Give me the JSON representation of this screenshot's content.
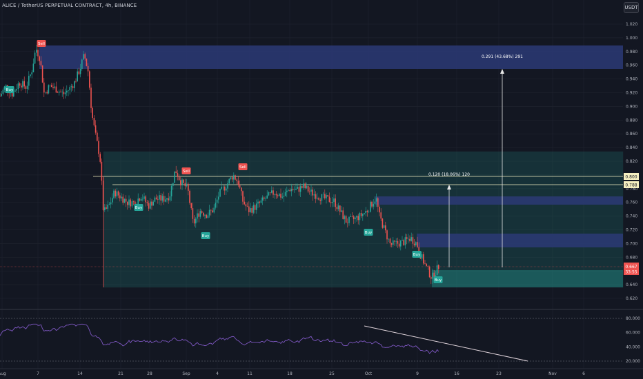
{
  "header": {
    "title": "ALICE / TetherUS PERPETUAL CONTRACT, 4h, BINANCE",
    "currency": "USDT"
  },
  "price_axis": {
    "ticks": [
      "1.020",
      "1.000",
      "0.980",
      "0.960",
      "0.940",
      "0.920",
      "0.900",
      "0.880",
      "0.860",
      "0.840",
      "0.820",
      "0.800",
      "0.780",
      "0.760",
      "0.740",
      "0.720",
      "0.700",
      "0.680",
      "0.660",
      "0.640",
      "0.620"
    ],
    "tick_values": [
      1.02,
      1.0,
      0.98,
      0.96,
      0.94,
      0.92,
      0.9,
      0.88,
      0.86,
      0.84,
      0.82,
      0.8,
      0.78,
      0.76,
      0.74,
      0.72,
      0.7,
      0.68,
      0.66,
      0.64,
      0.62
    ],
    "label_800": "0.800",
    "label_788": "0.788",
    "last_price": "0.667",
    "countdown": "33:55"
  },
  "rsi_axis": {
    "ticks": [
      "80.000",
      "60.000",
      "40.000",
      "20.000"
    ],
    "tick_values": [
      80,
      60,
      40,
      20
    ]
  },
  "time_axis": {
    "labels": [
      "Aug",
      "7",
      "14",
      "21",
      "28",
      "Sep",
      "4",
      "11",
      "18",
      "25",
      "Oct",
      "9",
      "16",
      "23",
      "Nov",
      "6"
    ]
  },
  "measures": {
    "upper": "0.291 (43.68%) 291",
    "lower": "0.120 (18.06%) 120"
  },
  "signals": {
    "sell": "Sell",
    "buy": "Buy"
  },
  "colors": {
    "background": "#131722",
    "up": "#26a69a",
    "down": "#ef5350",
    "zone_blue": "#2b3a75",
    "zone_green": "#2c5a52",
    "rsi": "#7e57c2",
    "trendline": "#e1d5dc",
    "level_line": "#f5efc0"
  }
}
